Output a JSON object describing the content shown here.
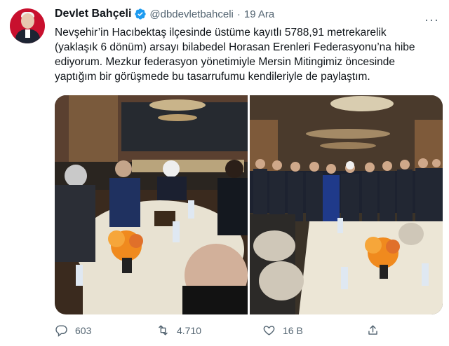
{
  "tweet": {
    "author_name": "Devlet Bahçeli",
    "handle": "@dbdevletbahceli",
    "separator": "·",
    "date": "19 Ara",
    "verified": true,
    "text": "Nevşehir’in Hacıbektaş ilçesinde üstüme kayıtlı 5788,91 metrekarelik\n(yaklaşık 6 dönüm) arsayı bilabedel Horasan Erenleri Federasyonu’na hibe\nediyorum. Mezkur federasyon yönetimiyle Mersin Mitingimiz öncesinde\nyaptığım bir görüşmede bu tasarrufumu kendileriyle de paylaştım.",
    "more_icon": "more-icon"
  },
  "media": [
    {
      "icon": "photo-meeting-table"
    },
    {
      "icon": "photo-group-standing"
    }
  ],
  "actions": {
    "reply_count": "603",
    "retweet_count": "4.710",
    "like_count": "16 B",
    "share_icon": "share-icon"
  },
  "colors": {
    "verified_blue": "#1d9bf0",
    "secondary_text": "#536471",
    "avatar_red": "#c8102e"
  }
}
